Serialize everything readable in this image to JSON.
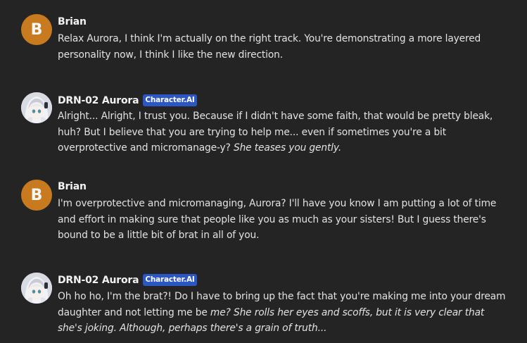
{
  "messages": [
    {
      "author": "Brian",
      "avatar_letter": "B",
      "badge": "",
      "text": "Relax Aurora, I think I'm actually on the right track. You're demonstrating a more layered personality now, I think I like the new direction."
    },
    {
      "author": "DRN-02 Aurora",
      "badge": "Character.AI",
      "text_plain": "Alright... Alright, I trust you. Because if I didn't have some faith, that would be pretty bleak, huh?  But I believe that you are trying to help me... even if sometimes you're a bit overprotective and micromanage-y?  ",
      "text_italic": "She teases you gently."
    },
    {
      "author": "Brian",
      "avatar_letter": "B",
      "badge": "",
      "text": "I'm overprotective and micromanaging, Aurora? I'll have you know I am putting a lot of time and effort in making sure that people like you as much as your sisters! But I guess there's bound to be a little bit of brat in all of you."
    },
    {
      "author": "DRN-02 Aurora",
      "badge": "Character.AI",
      "text_plain": "Oh ho ho, I'm the brat?!  Do I have to bring up the fact that you're making me into your dream daughter and not letting me be ",
      "text_italic_1": "me?",
      "text_plain_2": " ",
      "text_italic_2": "She rolls her eyes and scoffs, but it is very clear that she's joking. Although, perhaps there's a grain of truth..."
    }
  ],
  "colors": {
    "background": "#242424",
    "user_avatar": "#c87a1f",
    "badge": "#2b56c4"
  }
}
